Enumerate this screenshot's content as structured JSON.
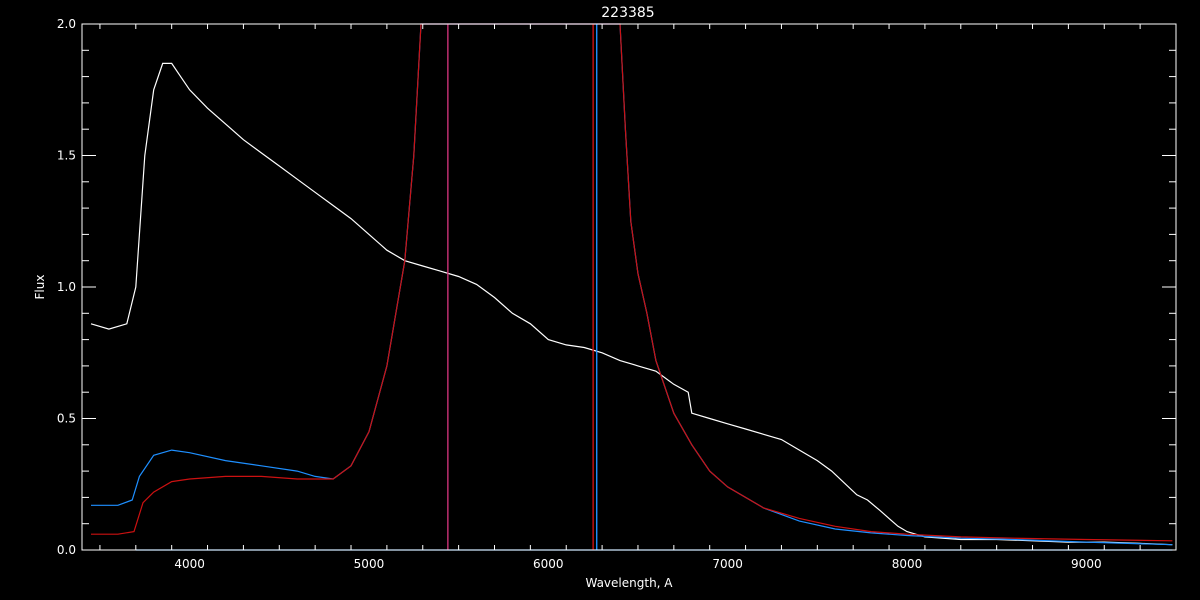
{
  "chart_data": {
    "type": "line",
    "title": "223385",
    "xlabel": "Wavelength, A",
    "ylabel": "Flux",
    "xlim": [
      3400,
      9500
    ],
    "ylim": [
      0,
      2
    ],
    "xticks": [
      4000,
      5000,
      6000,
      7000,
      8000,
      9000
    ],
    "xtick_labels": [
      "4000",
      "5000",
      "6000",
      "7000",
      "8000",
      "9000"
    ],
    "yticks": [
      0,
      0.5,
      1,
      1.5,
      2
    ],
    "ytick_labels": [
      "0.0",
      "0.5",
      "1.0",
      "1.5",
      "2.0"
    ],
    "background": "#000000",
    "axis_color": "#ffffff",
    "series": [
      {
        "color": "#ffffff",
        "x": [
          3450,
          3550,
          3650,
          3700,
          3750,
          3800,
          3850,
          3900,
          3950,
          4000,
          4100,
          4200,
          4300,
          4400,
          4500,
          4600,
          4700,
          4800,
          4900,
          5000,
          5100,
          5200,
          5300,
          5400,
          5500,
          5600,
          5700,
          5800,
          5900,
          6000,
          6100,
          6200,
          6300,
          6400,
          6500,
          6600,
          6700,
          6780,
          6800,
          6900,
          7000,
          7100,
          7200,
          7300,
          7400,
          7500,
          7580,
          7720,
          7780,
          7850,
          7900,
          7950,
          8000,
          8100,
          8300,
          8500,
          8700,
          8900,
          9100,
          9300,
          9480
        ],
        "y": [
          0.86,
          0.84,
          0.86,
          1.0,
          1.5,
          1.75,
          1.85,
          1.85,
          1.8,
          1.75,
          1.68,
          1.62,
          1.56,
          1.51,
          1.46,
          1.41,
          1.36,
          1.31,
          1.26,
          1.2,
          1.14,
          1.1,
          1.08,
          1.06,
          1.04,
          1.01,
          0.96,
          0.9,
          0.86,
          0.8,
          0.78,
          0.77,
          0.75,
          0.72,
          0.7,
          0.68,
          0.63,
          0.6,
          0.52,
          0.5,
          0.48,
          0.46,
          0.44,
          0.42,
          0.38,
          0.34,
          0.3,
          0.21,
          0.19,
          0.15,
          0.12,
          0.09,
          0.07,
          0.05,
          0.04,
          0.04,
          0.035,
          0.03,
          0.03,
          0.025,
          0.02
        ]
      },
      {
        "color": "#1e8fff",
        "x": [
          3450,
          3600,
          3680,
          3720,
          3800,
          3900,
          4000,
          4200,
          4400,
          4600,
          4700,
          4800,
          4900,
          5000,
          5100,
          5200,
          5250,
          5290,
          5300,
          6400,
          6430,
          6460,
          6500,
          6550,
          6600,
          6700,
          6800,
          6900,
          7000,
          7200,
          7400,
          7600,
          7800,
          8000,
          8300,
          8600,
          9000,
          9480
        ],
        "y": [
          0.17,
          0.17,
          0.19,
          0.28,
          0.36,
          0.38,
          0.37,
          0.34,
          0.32,
          0.3,
          0.28,
          0.27,
          0.32,
          0.45,
          0.7,
          1.1,
          1.5,
          2.0,
          2.0,
          2.0,
          1.6,
          1.25,
          1.05,
          0.9,
          0.72,
          0.52,
          0.4,
          0.3,
          0.24,
          0.16,
          0.11,
          0.08,
          0.065,
          0.055,
          0.045,
          0.04,
          0.03,
          0.02
        ]
      },
      {
        "color": "#cc1111",
        "x": [
          3450,
          3600,
          3690,
          3740,
          3800,
          3900,
          4000,
          4200,
          4400,
          4600,
          4700,
          4800,
          4900,
          5000,
          5100,
          5200,
          5250,
          5290,
          5300,
          6400,
          6430,
          6460,
          6500,
          6550,
          6600,
          6700,
          6800,
          6900,
          7000,
          7200,
          7400,
          7600,
          7800,
          8000,
          8300,
          8600,
          9000,
          9480
        ],
        "y": [
          0.06,
          0.06,
          0.07,
          0.18,
          0.22,
          0.26,
          0.27,
          0.28,
          0.28,
          0.27,
          0.27,
          0.27,
          0.32,
          0.45,
          0.7,
          1.1,
          1.5,
          2.0,
          2.0,
          2.0,
          1.6,
          1.25,
          1.05,
          0.9,
          0.72,
          0.52,
          0.4,
          0.3,
          0.24,
          0.16,
          0.12,
          0.09,
          0.07,
          0.06,
          0.05,
          0.045,
          0.04,
          0.035
        ]
      },
      {
        "color": "#1e8fff",
        "x": [
          3700,
          9480
        ],
        "y": [
          0.0,
          0.0
        ]
      }
    ],
    "vertical_lines": [
      {
        "x": 5440,
        "color": "#cc3377"
      },
      {
        "x": 6250,
        "color": "#cc1111"
      },
      {
        "x": 6270,
        "color": "#1e8fff"
      }
    ]
  }
}
